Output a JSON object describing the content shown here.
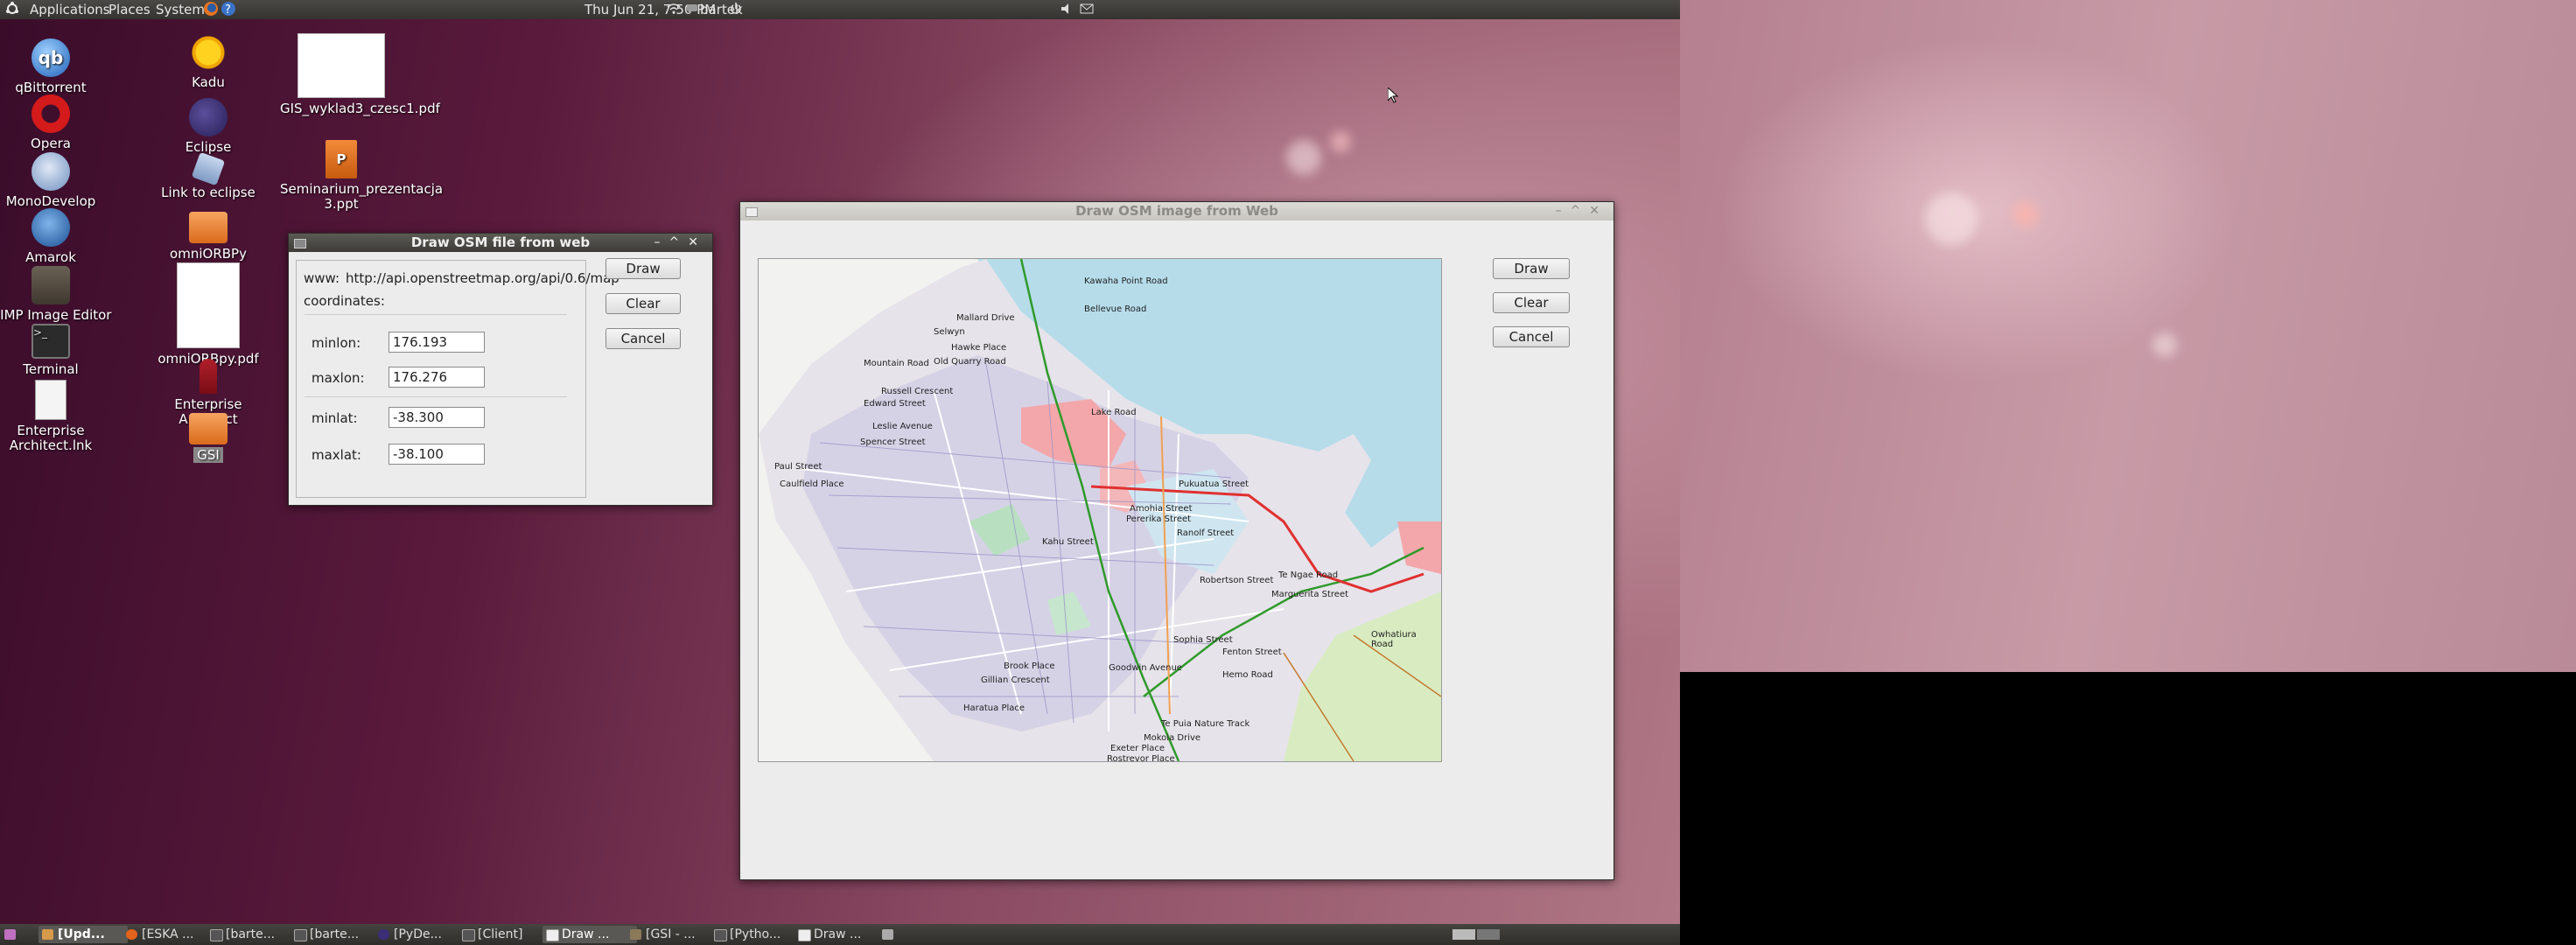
{
  "top_panel": {
    "menus": [
      "Applications",
      "Places",
      "System"
    ],
    "clock": "Thu Jun 21,  7:50 PM",
    "user": "bartek"
  },
  "desktop_icons": [
    {
      "label": "qBittorrent"
    },
    {
      "label": "Opera"
    },
    {
      "label": "MonoDevelop"
    },
    {
      "label": "Amarok"
    },
    {
      "label": "GIMP Image Editor"
    },
    {
      "label": "Terminal"
    },
    {
      "label": "Enterprise Architect.lnk"
    },
    {
      "label": "Kadu"
    },
    {
      "label": "Eclipse"
    },
    {
      "label": "Link to eclipse"
    },
    {
      "label": "omniORBPy"
    },
    {
      "label": "omniORBpy.pdf"
    },
    {
      "label": "Enterprise Architect"
    },
    {
      "label": "GSI"
    },
    {
      "label": "GIS_wyklad3_czesc1.pdf"
    },
    {
      "label": "Seminarium_prezentacja 3.ppt"
    }
  ],
  "dialog": {
    "title": "Draw OSM file from web",
    "www_label": "www:",
    "www_value": "http://api.openstreetmap.org/api/0.6/map",
    "coordinates_label": "coordinates:",
    "minlon_label": "minlon:",
    "minlon_value": "176.193",
    "maxlon_label": "maxlon:",
    "maxlon_value": "176.276",
    "minlat_label": "minlat:",
    "minlat_value": "-38.300",
    "maxlat_label": "maxlat:",
    "maxlat_value": "-38.100",
    "draw": "Draw",
    "clear": "Clear",
    "cancel": "Cancel"
  },
  "main_window": {
    "title": "Draw OSM image from Web",
    "draw": "Draw",
    "clear": "Clear",
    "cancel": "Cancel",
    "map_labels": [
      "Kawaha Point Road",
      "Bellevue Road",
      "Mallard Drive",
      "Selwyn",
      "Hawke Place",
      "Old Quarry Road",
      "Mountain Road",
      "Russell Crescent",
      "Edward Street",
      "Leslie Avenue",
      "Spencer Street",
      "Paul Street",
      "Caulfield Place",
      "Sophia Street",
      "Te Ngae Road",
      "Owhatiura Road",
      "Hemo Road",
      "Te Puia Nature Track",
      "Exeter Place",
      "Rostrevor Place",
      "Haratua Place",
      "Brook Place",
      "Gillian Crescent",
      "Goodwin Avenue",
      "Fenton Street",
      "Pukuatua Street",
      "Ranolf Street",
      "Marguerita Street",
      "Robertson Street",
      "Amohia Street",
      "Lake Road",
      "Pererika Street",
      "Kahu Street",
      "Mokoia Drive"
    ]
  },
  "taskbar": [
    "[Upd...",
    "[ESKA ...",
    "[barte...",
    "[barte...",
    "[PyDe...",
    "[Client]",
    "Draw ...",
    "[GSI - ...",
    "[Pytho...",
    "Draw ..."
  ]
}
